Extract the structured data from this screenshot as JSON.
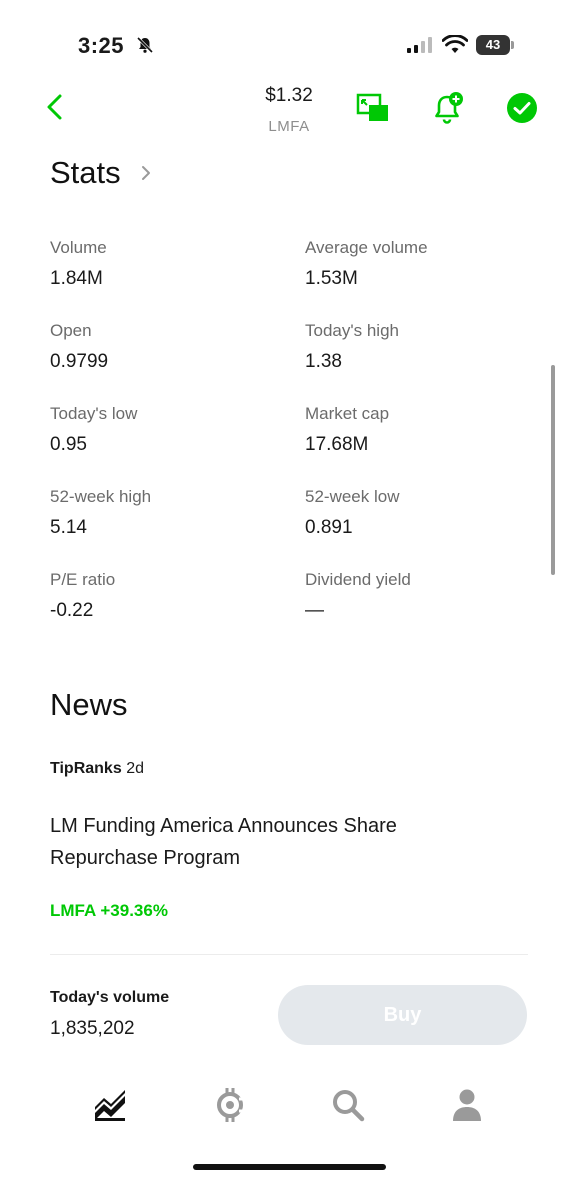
{
  "status_bar": {
    "time": "3:25",
    "battery": "43"
  },
  "header": {
    "price": "$1.32",
    "ticker": "LMFA"
  },
  "stats": {
    "title": "Stats",
    "items": [
      {
        "label": "Volume",
        "value": "1.84M"
      },
      {
        "label": "Average volume",
        "value": "1.53M"
      },
      {
        "label": "Open",
        "value": "0.9799"
      },
      {
        "label": "Today's high",
        "value": "1.38"
      },
      {
        "label": "Today's low",
        "value": "0.95"
      },
      {
        "label": "Market cap",
        "value": "17.68M"
      },
      {
        "label": "52-week high",
        "value": "5.14"
      },
      {
        "label": "52-week low",
        "value": "0.891"
      },
      {
        "label": "P/E ratio",
        "value": "-0.22"
      },
      {
        "label": "Dividend yield",
        "value": "—"
      }
    ]
  },
  "news": {
    "title": "News",
    "source": "TipRanks",
    "age": "2d",
    "headline": "LM Funding America Announces Share Repurchase Program",
    "ticker_change": "LMFA +39.36%"
  },
  "bottom": {
    "volume_label": "Today's volume",
    "volume_value": "1,835,202",
    "buy_label": "Buy"
  },
  "colors": {
    "accent": "#00c805",
    "buy_disabled": "#e4e8ec"
  },
  "icons": {
    "back": "chevron-left-icon",
    "picture_in_picture": "pip-icon",
    "alert": "bell-plus-icon",
    "watchlist": "check-circle-icon",
    "tabs": [
      "chart-icon",
      "crypto-icon",
      "search-icon",
      "account-icon"
    ]
  }
}
